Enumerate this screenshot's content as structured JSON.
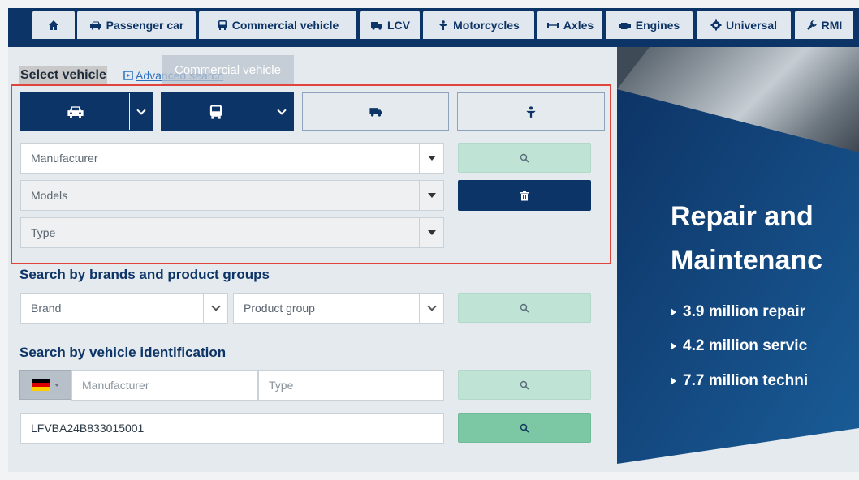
{
  "tabs": [
    {
      "label": "",
      "icon": "home-icon"
    },
    {
      "label": "Passenger car",
      "icon": "car-icon"
    },
    {
      "label": "Commercial vehicle",
      "icon": "bus-icon"
    },
    {
      "label": "LCV",
      "icon": "truck-icon"
    },
    {
      "label": "Motorcycles",
      "icon": "motorcycle-icon"
    },
    {
      "label": "Axles",
      "icon": "axle-icon"
    },
    {
      "label": "Engines",
      "icon": "engine-icon"
    },
    {
      "label": "Universal",
      "icon": "gear-icon"
    },
    {
      "label": "RMI",
      "icon": "wrench-icon"
    }
  ],
  "select_vehicle": {
    "title": "Select vehicle",
    "advanced_search": "Advanced search",
    "tooltip": "Commercial vehicle"
  },
  "vehicle_type_buttons": [
    "car-icon",
    "bus-icon",
    "truck-icon",
    "motorcycle-icon"
  ],
  "fields": {
    "manufacturer": "Manufacturer",
    "models": "Models",
    "type": "Type"
  },
  "brands_section": {
    "title": "Search by brands and product groups",
    "brand": "Brand",
    "product_group": "Product group"
  },
  "vin_section": {
    "title": "Search by vehicle identification",
    "manufacturer_placeholder": "Manufacturer",
    "type_placeholder": "Type",
    "vin_value": "LFVBA24B833015001"
  },
  "hero": {
    "title_line1": "Repair and",
    "title_line2": "Maintenanc",
    "bullets": [
      "3.9 million repair",
      "4.2 million servic",
      "7.7 million techni"
    ]
  },
  "colors": {
    "navy": "#0d3466",
    "tab_bg": "#e1e7ee",
    "panel_bg": "#e5eaee",
    "search_soft": "#bfe3d4",
    "search_mid": "#7cc8a5",
    "highlight_border": "#e0443c"
  }
}
